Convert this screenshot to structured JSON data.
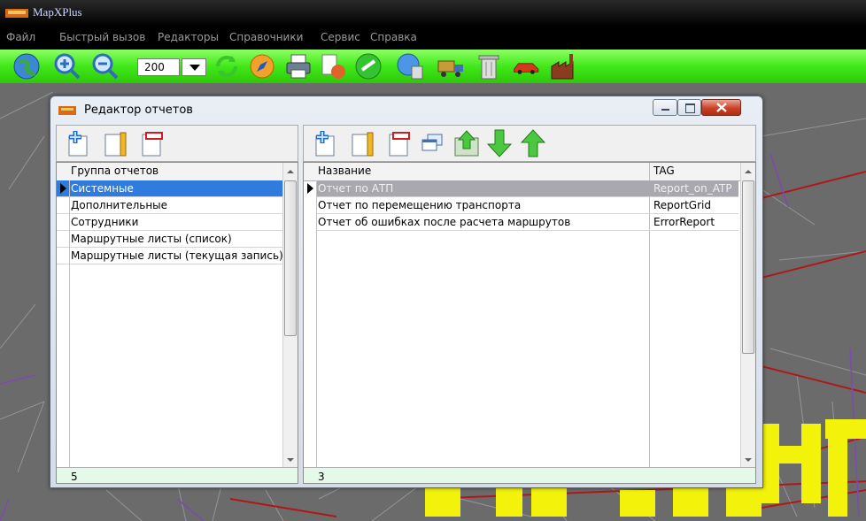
{
  "app": {
    "title": "MapXPlus"
  },
  "menu": [
    "Файл",
    "Быстрый вызов",
    "Редакторы",
    "Справочники",
    "Сервис",
    "Справка"
  ],
  "toolbar": {
    "zoom_value": "200",
    "icons": [
      "globe-icon",
      "zoom-in-icon",
      "zoom-out-icon",
      "refresh-icon",
      "compass-icon",
      "printer-icon",
      "report-icon",
      "checkmark-icon",
      "network-icon",
      "truck-icon",
      "trash-icon",
      "car-icon",
      "factory-icon"
    ]
  },
  "dialog": {
    "title": "Редактор отчетов",
    "left_grid": {
      "header": "Группа отчетов",
      "rows": [
        "Системные",
        "Дополнительные",
        "Сотрудники",
        "Маршрутные листы (список)",
        "Маршрутные листы (текущая запись)"
      ],
      "selected_index": 0,
      "footer_count": "5"
    },
    "right_grid": {
      "headers": {
        "name": "Название",
        "tag": "TAG"
      },
      "rows": [
        {
          "name": "Отчет по АТП",
          "tag": "Report_on_ATP"
        },
        {
          "name": "Отчет по перемещению транспорта",
          "tag": "ReportGrid"
        },
        {
          "name": "Отчет об ошибках после расчета маршрутов",
          "tag": "ErrorReport"
        }
      ],
      "selected_index": 0,
      "footer_count": "3"
    }
  },
  "colors": {
    "toolbar_green": "#41e81b",
    "selection_blue": "#2f7bde",
    "footer_green": "#e5f9e9",
    "map_gray": "#6b6b6b",
    "map_yellow": "#f2f20a",
    "road_red": "#b01818"
  }
}
